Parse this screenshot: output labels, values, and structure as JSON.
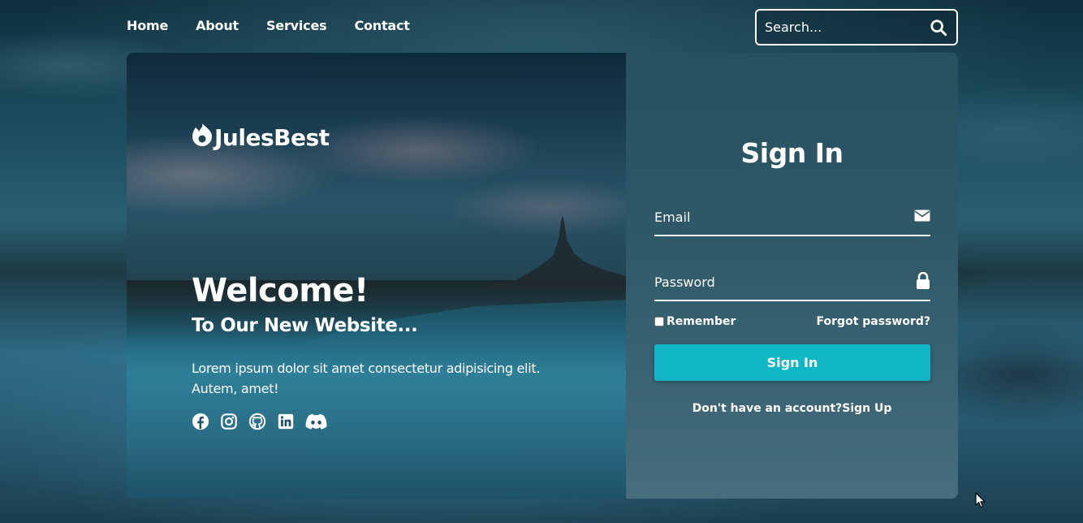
{
  "nav": {
    "items": [
      {
        "label": "Home"
      },
      {
        "label": "About"
      },
      {
        "label": "Services"
      },
      {
        "label": "Contact"
      }
    ]
  },
  "search": {
    "placeholder": "Search...",
    "icon": "search-icon"
  },
  "hero": {
    "brand": "JulesBest",
    "brand_icon": "flame-icon",
    "welcome": "Welcome!",
    "tagline": "To Our New Website...",
    "description": "Lorem ipsum dolor sit amet consectetur adipisicing elit. Autem, amet!",
    "social_icons": [
      "facebook-icon",
      "instagram-icon",
      "github-icon",
      "linkedin-icon",
      "discord-icon"
    ]
  },
  "signin": {
    "title": "Sign In",
    "email_placeholder": "Email",
    "email_icon": "envelope-icon",
    "password_placeholder": "Password",
    "password_icon": "lock-icon",
    "remember_label": "Remember",
    "forgot_label": "Forgot password?",
    "button_label": "Sign In",
    "no_account_text": "Don't have an account?",
    "signup_link": "Sign Up"
  },
  "colors": {
    "accent": "#10b6c6",
    "text": "#ffffff"
  }
}
